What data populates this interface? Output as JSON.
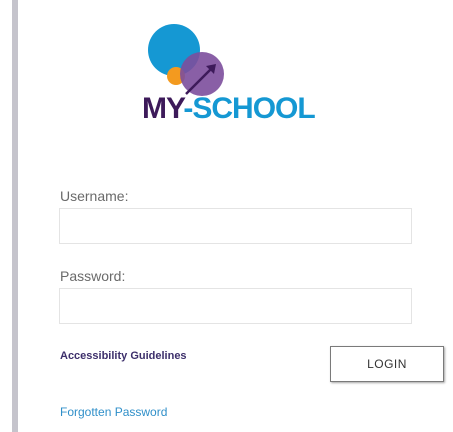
{
  "logo": {
    "text_my": "MY",
    "text_school": "-SCHOOL",
    "colors": {
      "blue": "#1598d3",
      "purple": "#7c4e9c",
      "orange": "#f39a1f",
      "dark_purple": "#3d1a5a"
    }
  },
  "form": {
    "username_label": "Username:",
    "username_value": "",
    "password_label": "Password:",
    "password_value": ""
  },
  "links": {
    "accessibility": "Accessibility Guidelines",
    "forgotten_password": "Forgotten Password"
  },
  "buttons": {
    "login": "LOGIN"
  }
}
